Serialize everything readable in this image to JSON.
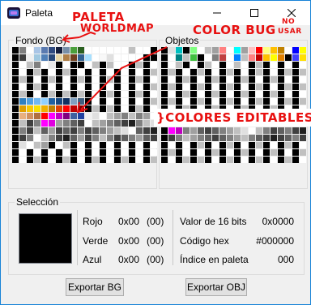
{
  "window": {
    "title": "Paleta"
  },
  "groups": {
    "bg": "Fondo (BG)",
    "obj": "Objetos",
    "selection": "Selección"
  },
  "palettes": {
    "bg": [
      [
        "#000000",
        "#808080",
        "#ffffff",
        "#a9c5e6",
        "#5a7ab0",
        "#2e4a80",
        "#141e3c",
        "#788fa8",
        "#4aa03c",
        "#2a6020",
        "#ffffff",
        "#ffffff",
        "#ffffff",
        "#ffffff",
        "#ffffff",
        "#ffffff",
        "#c0c0c0",
        "#ffffff",
        "#ffffff",
        "#000000"
      ],
      [
        "#000000",
        "#404040",
        "#f0f0f0",
        "#a0c8e0",
        "#5080b8",
        "#284878",
        "#e8d8a8",
        "#b08048",
        "#704020",
        "#306090",
        "#a8e0ff",
        "#ffffff",
        "#f8f8f8",
        "#e0e0e0",
        "#ffffff",
        "#ffffff",
        "#ffffff",
        "#ffffff",
        "#000000",
        "#000000"
      ],
      [
        "#000000",
        "#ffffff",
        "#c0c0c0",
        "#808080",
        "#ffffff",
        "#e8e8e8",
        "#000000",
        "#ffffff",
        "#000000",
        "#000000",
        "#ffffff",
        "#c0c0c0",
        "#000000",
        "#c0c0c0",
        "#ffffff",
        "#ffffff",
        "#000000",
        "#c0c0c0",
        "#000000",
        "#ffffff"
      ],
      [
        "#000000",
        "#ffffff",
        "#000000",
        "#c0c0c0",
        "#000000",
        "#ffffff",
        "#000000",
        "#c0c0c0",
        "#000000",
        "#ffffff",
        "#000000",
        "#ffffff",
        "#000000",
        "#ffffff",
        "#000000",
        "#ffffff",
        "#000000",
        "#ffffff",
        "#000000",
        "#c0c0c0"
      ],
      [
        "#000000",
        "#c0c0c0",
        "#000000",
        "#ffffff",
        "#000000",
        "#c0c0c0",
        "#000000",
        "#ffffff",
        "#000000",
        "#c0c0c0",
        "#000000",
        "#ffffff",
        "#000000",
        "#c0c0c0",
        "#000000",
        "#ffffff",
        "#000000",
        "#c0c0c0",
        "#000000",
        "#ffffff"
      ],
      [
        "#000000",
        "#ffffff",
        "#000000",
        "#c0c0c0",
        "#000000",
        "#ffffff",
        "#000000",
        "#ffffff",
        "#000000",
        "#ffffff",
        "#000000",
        "#ffffff",
        "#000000",
        "#ffffff",
        "#000000",
        "#ffffff",
        "#000000",
        "#ffffff",
        "#000000",
        "#c0c0c0"
      ],
      [
        "#000000",
        "#c0c0c0",
        "#000000",
        "#ffffff",
        "#000000",
        "#c0c0c0",
        "#000000",
        "#c0c0c0",
        "#000000",
        "#c0c0c0",
        "#000000",
        "#ffffff",
        "#000000",
        "#c0c0c0",
        "#000000",
        "#ffffff",
        "#000000",
        "#c0c0c0",
        "#000000",
        "#ffffff"
      ],
      [
        "#000000",
        "#3080c0",
        "#50a0e0",
        "#70b8f0",
        "#90d0ff",
        "#2060a0",
        "#184880",
        "#103060",
        "#80a0c0",
        "#406080",
        "#000000",
        "#ffffff",
        "#000000",
        "#ffffff",
        "#000000",
        "#ffffff",
        "#000000",
        "#ffffff",
        "#000000",
        "#c0c0c0"
      ],
      [
        "#000000",
        "#e0a000",
        "#f8c800",
        "#f8e000",
        "#f0b000",
        "#c08000",
        "#e04000",
        "#ff0000",
        "#c00000",
        "#800000",
        "#000000",
        "#c0c0c0",
        "#000000",
        "#c0c0c0",
        "#000000",
        "#ffffff",
        "#000000",
        "#c0c0c0",
        "#000000",
        "#ffffff"
      ],
      [
        "#000000",
        "#e8b080",
        "#d09060",
        "#b07040",
        "#ff0000",
        "#ff00ff",
        "#c000c0",
        "#800080",
        "#4060a0",
        "#2040a0",
        "#f0f0f0",
        "#e0e0e0",
        "#ffffff",
        "#c0c0c0",
        "#a0a0a0",
        "#808080",
        "#c0c0c0",
        "#808080",
        "#a0a0a0",
        "#ffffff"
      ],
      [
        "#000000",
        "#c0c0c0",
        "#404040",
        "#808080",
        "#ff00ff",
        "#e000e0",
        "#a0a0a0",
        "#808080",
        "#606060",
        "#404040",
        "#ffffff",
        "#c0c0c0",
        "#a0a0a0",
        "#808080",
        "#606060",
        "#404040",
        "#202020",
        "#808080",
        "#c0c0c0",
        "#e0e0e0"
      ],
      [
        "#000000",
        "#808080",
        "#404040",
        "#c0c0c0",
        "#606060",
        "#a0a0a0",
        "#404040",
        "#606060",
        "#404040",
        "#808080",
        "#404040",
        "#606060",
        "#808080",
        "#a0a0a0",
        "#c0c0c0",
        "#e0e0e0",
        "#ffffff",
        "#606060",
        "#404040",
        "#202020"
      ],
      [
        "#000000",
        "#404040",
        "#808080",
        "#ffffff",
        "#c0c0c0",
        "#808080",
        "#404040",
        "#202020",
        "#606060",
        "#a0a0a0",
        "#404040",
        "#808080",
        "#c0c0c0",
        "#808080",
        "#404040",
        "#606060",
        "#808080",
        "#a0a0a0",
        "#606060",
        "#404040"
      ],
      [
        "#000000",
        "#e0e0e0",
        "#ffffff",
        "#c0c0c0",
        "#a0a0a0",
        "#000000",
        "#ffffff",
        "#c0c0c0",
        "#000000",
        "#ffffff",
        "#000000",
        "#ffffff",
        "#000000",
        "#ffffff",
        "#000000",
        "#ffffff",
        "#000000",
        "#ffffff",
        "#000000",
        "#ffffff"
      ],
      [
        "#000000",
        "#ffffff",
        "#000000",
        "#ffffff",
        "#000000",
        "#ffffff",
        "#000000",
        "#ffffff",
        "#000000",
        "#ffffff",
        "#000000",
        "#ffffff",
        "#000000",
        "#ffffff",
        "#000000",
        "#ffffff",
        "#000000",
        "#ffffff",
        "#000000",
        "#ffffff"
      ],
      [
        "#000000",
        "#ffffff",
        "#000000",
        "#c0c0c0",
        "#000000",
        "#ffffff",
        "#000000",
        "#c0c0c0",
        "#000000",
        "#ffffff",
        "#000000",
        "#c0c0c0",
        "#000000",
        "#ffffff",
        "#000000",
        "#c0c0c0",
        "#000000",
        "#ffffff",
        "#000000",
        "#c0c0c0"
      ]
    ],
    "obj": [
      [
        "#000000",
        "#e0e0e0",
        "#00c0c0",
        "#000000",
        "#80ff80",
        "#ffffff",
        "#c0c0c0",
        "#a0a0a0",
        "#ff8080",
        "#ffffff",
        "#00ffff",
        "#a0a0a0",
        "#ffc0c0",
        "#ff0000",
        "#ffff80",
        "#ffc000",
        "#c08000",
        "#ffffff",
        "#0000ff",
        "#ffff00"
      ],
      [
        "#000000",
        "#ffffff",
        "#008080",
        "#c0c0c0",
        "#40c040",
        "#000000",
        "#ffffff",
        "#808080",
        "#c04040",
        "#ffffff",
        "#0080ff",
        "#c0c0c0",
        "#ff8080",
        "#c00000",
        "#ffc000",
        "#ffff00",
        "#e08000",
        "#000000",
        "#4040ff",
        "#ffe000"
      ],
      [
        "#000000",
        "#ffffff",
        "#c0c0c0",
        "#000000",
        "#ffffff",
        "#000000",
        "#c0c0c0",
        "#ffffff",
        "#000000",
        "#ffffff",
        "#c0c0c0",
        "#ffffff",
        "#000000",
        "#c0c0c0",
        "#000000",
        "#ffffff",
        "#000000",
        "#ffffff",
        "#000000",
        "#ffffff"
      ],
      [
        "#000000",
        "#c0c0c0",
        "#000000",
        "#ffffff",
        "#000000",
        "#c0c0c0",
        "#000000",
        "#ffffff",
        "#000000",
        "#c0c0c0",
        "#000000",
        "#ffffff",
        "#000000",
        "#c0c0c0",
        "#000000",
        "#ffffff",
        "#000000",
        "#c0c0c0",
        "#000000",
        "#c0c0c0"
      ],
      [
        "#000000",
        "#ffffff",
        "#000000",
        "#c0c0c0",
        "#000000",
        "#ffffff",
        "#000000",
        "#c0c0c0",
        "#000000",
        "#ffffff",
        "#000000",
        "#c0c0c0",
        "#000000",
        "#ffffff",
        "#000000",
        "#c0c0c0",
        "#000000",
        "#ffffff",
        "#000000",
        "#ffffff"
      ],
      [
        "#000000",
        "#c0c0c0",
        "#000000",
        "#ffffff",
        "#000000",
        "#c0c0c0",
        "#000000",
        "#ffffff",
        "#000000",
        "#c0c0c0",
        "#000000",
        "#ffffff",
        "#000000",
        "#c0c0c0",
        "#000000",
        "#ffffff",
        "#000000",
        "#c0c0c0",
        "#000000",
        "#c0c0c0"
      ],
      [
        "#000000",
        "#ffffff",
        "#000000",
        "#c0c0c0",
        "#000000",
        "#ffffff",
        "#000000",
        "#c0c0c0",
        "#000000",
        "#ffffff",
        "#000000",
        "#c0c0c0",
        "#000000",
        "#ffffff",
        "#000000",
        "#c0c0c0",
        "#000000",
        "#ffffff",
        "#000000",
        "#ffffff"
      ],
      [
        "#000000",
        "#c0c0c0",
        "#000000",
        "#ffffff",
        "#000000",
        "#c0c0c0",
        "#000000",
        "#ffffff",
        "#000000",
        "#c0c0c0",
        "#000000",
        "#ffffff",
        "#000000",
        "#c0c0c0",
        "#000000",
        "#ffffff",
        "#000000",
        "#c0c0c0",
        "#000000",
        "#c0c0c0"
      ],
      [
        "#000000",
        "#ffffff",
        "#000000",
        "#c0c0c0",
        "#000000",
        "#ffffff",
        "#000000",
        "#c0c0c0",
        "#000000",
        "#ffffff",
        "#000000",
        "#c0c0c0",
        "#000000",
        "#ffffff",
        "#000000",
        "#c0c0c0",
        "#000000",
        "#ffffff",
        "#000000",
        "#ffffff"
      ],
      [
        "#000000",
        "#c0c0c0",
        "#000000",
        "#ffffff",
        "#000000",
        "#c0c0c0",
        "#000000",
        "#ffffff",
        "#000000",
        "#c0c0c0",
        "#000000",
        "#ffffff",
        "#000000",
        "#c0c0c0",
        "#000000",
        "#ffffff",
        "#000000",
        "#c0c0c0",
        "#000000",
        "#c0c0c0"
      ],
      [
        "#000000",
        "#ff00ff",
        "#000000",
        "#e0e0e0",
        "#ffffff",
        "#c0c0c0",
        "#a0a0a0",
        "#808080",
        "#606060",
        "#404040",
        "#ffffff",
        "#c0c0c0",
        "#a0a0a0",
        "#808080",
        "#606060",
        "#404040",
        "#202020",
        "#808080",
        "#c0c0c0",
        "#e0e0e0"
      ],
      [
        "#000000",
        "#ff00ff",
        "#c000c0",
        "#808080",
        "#a0a0a0",
        "#606060",
        "#404040",
        "#606060",
        "#808080",
        "#a0a0a0",
        "#c0c0c0",
        "#e0e0e0",
        "#ffffff",
        "#c0c0c0",
        "#808080",
        "#404040",
        "#606060",
        "#808080",
        "#404040",
        "#202020"
      ],
      [
        "#000000",
        "#404040",
        "#808080",
        "#c0c0c0",
        "#a0a0a0",
        "#808080",
        "#606060",
        "#404040",
        "#606060",
        "#808080",
        "#a0a0a0",
        "#c0c0c0",
        "#808080",
        "#606060",
        "#404040",
        "#202020",
        "#404040",
        "#606060",
        "#808080",
        "#404040"
      ],
      [
        "#000000",
        "#ffffff",
        "#000000",
        "#ffffff",
        "#000000",
        "#c0c0c0",
        "#000000",
        "#ffffff",
        "#000000",
        "#c0c0c0",
        "#000000",
        "#ffffff",
        "#000000",
        "#c0c0c0",
        "#000000",
        "#ffffff",
        "#000000",
        "#c0c0c0",
        "#000000",
        "#ffffff"
      ],
      [
        "#000000",
        "#c0c0c0",
        "#000000",
        "#ffffff",
        "#000000",
        "#ffffff",
        "#000000",
        "#c0c0c0",
        "#000000",
        "#ffffff",
        "#000000",
        "#c0c0c0",
        "#000000",
        "#ffffff",
        "#000000",
        "#c0c0c0",
        "#000000",
        "#ffffff",
        "#000000",
        "#c0c0c0"
      ],
      [
        "#000000",
        "#ffffff",
        "#000000",
        "#c0c0c0",
        "#000000",
        "#c0c0c0",
        "#000000",
        "#ffffff",
        "#000000",
        "#c0c0c0",
        "#000000",
        "#ffffff",
        "#000000",
        "#c0c0c0",
        "#000000",
        "#ffffff",
        "#000000",
        "#c0c0c0",
        "#000000",
        "#ffffff"
      ]
    ]
  },
  "selection": {
    "color": "#000000",
    "red_label": "Rojo",
    "red_hex": "0x00",
    "red_dec": "(00)",
    "green_label": "Verde",
    "green_hex": "0x00",
    "green_dec": "(00)",
    "blue_label": "Azul",
    "blue_hex": "0x00",
    "blue_dec": "(00)",
    "value16_label": "Valor de 16 bits",
    "value16": "0x0000",
    "hex_label": "Código hex",
    "hex": "#000000",
    "index_label": "Índice en paleta",
    "index": "000"
  },
  "buttons": {
    "export_bg": "Exportar BG",
    "export_obj": "Exportar OBJ"
  },
  "annotations": {
    "paleta": "PALETA",
    "worldmap": "WORLDMAP",
    "color_bug": "COLOR BUG",
    "no": "NO",
    "usar": "USAR",
    "colores": "}COLORES EDITABLES"
  }
}
